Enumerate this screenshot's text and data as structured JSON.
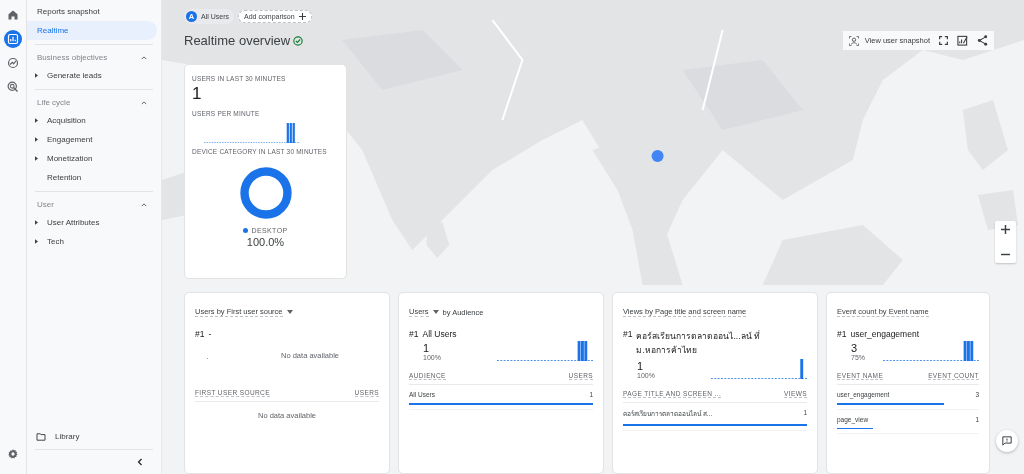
{
  "rail": {
    "items": [
      {
        "selected": false
      },
      {
        "selected": true
      },
      {
        "selected": false
      },
      {
        "selected": false
      }
    ]
  },
  "sidebar": {
    "top_items": [
      {
        "label": "Reports snapshot",
        "selected": false
      },
      {
        "label": "Realtime",
        "selected": true
      }
    ],
    "sections": [
      {
        "title": "Business objectives",
        "expanded": true,
        "items": [
          {
            "label": "Generate leads",
            "expandable": true
          }
        ]
      },
      {
        "title": "Life cycle",
        "expanded": true,
        "items": [
          {
            "label": "Acquisition",
            "expandable": true
          },
          {
            "label": "Engagement",
            "expandable": true
          },
          {
            "label": "Monetization",
            "expandable": true
          },
          {
            "label": "Retention",
            "expandable": false
          }
        ]
      },
      {
        "title": "User",
        "expanded": true,
        "items": [
          {
            "label": "User Attributes",
            "expandable": true
          },
          {
            "label": "Tech",
            "expandable": true
          }
        ]
      }
    ],
    "library": "Library"
  },
  "header": {
    "avatar": "A",
    "comparison": "All Users",
    "add_comparison": "Add comparison",
    "title": "Realtime overview",
    "snapshot_button": "View user snapshot"
  },
  "summary_card": {
    "users_label": "USERS IN LAST 30 MINUTES",
    "users_value": "1",
    "per_minute_label": "USERS PER MINUTE",
    "device_label": "DEVICE CATEGORY IN LAST 30 MINUTES",
    "legend": [
      {
        "label": "DESKTOP",
        "value": "100.0%",
        "color": "#1a73e8"
      }
    ]
  },
  "cards": [
    {
      "kind": "empty",
      "title": [
        {
          "text": "Users by First user source",
          "dropdown": true
        }
      ],
      "rank": "#1",
      "name": "-",
      "message": "No data available",
      "columns": [
        "FIRST USER SOURCE",
        "USERS"
      ],
      "table_message": "No data available"
    },
    {
      "kind": "data",
      "title": [
        {
          "text": "Users",
          "dropdown": true
        },
        {
          "text": "by Audience",
          "dropdown": false
        }
      ],
      "rank": "#1",
      "name": "All Users",
      "value": "1",
      "share": "100%",
      "columns": [
        "AUDIENCE",
        "USERS"
      ],
      "rows": [
        {
          "label": "All Users",
          "value": "1",
          "level": 1
        }
      ]
    },
    {
      "kind": "data",
      "title": [
        {
          "text": "Views by Page title and screen name",
          "dropdown": false
        }
      ],
      "rank": "#1",
      "name": "คอร์สเรียนการตลาดออนไ...ลน์ ที่ ม.หอการค้าไทย",
      "value": "1",
      "share": "100%",
      "columns": [
        "PAGE TITLE AND SCREEN ...",
        "VIEWS"
      ],
      "rows": [
        {
          "label": "คอร์สเรียนการตลาดออนไลน์ ส...",
          "value": "1",
          "level": 1
        }
      ]
    },
    {
      "kind": "data",
      "title": [
        {
          "text": "Event count by Event name",
          "dropdown": false
        }
      ],
      "rank": "#1",
      "name": "user_engagement",
      "value": "3",
      "share": "75%",
      "columns": [
        "EVENT NAME",
        "EVENT COUNT"
      ],
      "rows": [
        {
          "label": "user_engagement",
          "value": "3",
          "level": 0.75
        },
        {
          "label": "page_view",
          "value": "1",
          "level": 0.25
        }
      ]
    }
  ]
}
